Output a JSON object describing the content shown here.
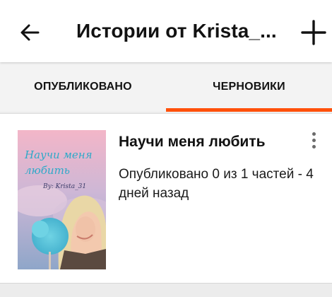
{
  "header": {
    "title": "Истории от Krista_...",
    "back_icon": "arrow-left-icon",
    "add_icon": "plus-icon"
  },
  "tabs": [
    {
      "label": "ОПУБЛИКОВАНО",
      "active": false
    },
    {
      "label": "ЧЕРНОВИКИ",
      "active": true
    }
  ],
  "colors": {
    "accent": "#ff500a",
    "tabs_bg": "#f3f3f3",
    "page_bg": "#ececec"
  },
  "stories": [
    {
      "title": "Научи меня любить",
      "meta": "Опубликовано 0 из 1 частей - 4 дней назад",
      "cover": {
        "title_text": "Научи меня любить",
        "author_text": "By: Krista_31"
      },
      "menu_icon": "more-vertical-icon"
    }
  ]
}
